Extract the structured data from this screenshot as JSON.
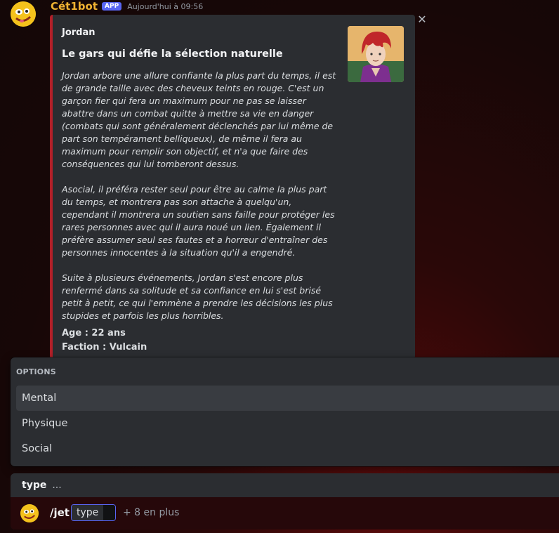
{
  "message": {
    "username": "Cét1bot",
    "badge": "APP",
    "timestamp": "Aujourd'hui à 09:56"
  },
  "embed": {
    "author": "Jordan",
    "title": "Le gars qui défie la sélection naturelle",
    "description": [
      "Jordan arbore une allure confiante la plus part du temps, il est de grande taille avec des cheveux teints en rouge. C'est un garçon fier qui fera un maximum pour ne pas se laisser abattre dans un combat quitte à mettre sa vie en danger (combats qui sont généralement déclenchés par lui même de part son tempérament belliqueux), de même il fera au maximum pour remplir son objectif, et n'a que faire des conséquences qui lui tomberont dessus.",
      "Asocial, il préféra rester seul pour être au calme la plus part du temps, et montrera pas son attache à quelqu'un, cependant il montrera un soutien sans faille pour protéger les rares personnes avec qui il aura noué un lien. Également il préfère assumer seul ses fautes et a horreur d'entraîner des personnes innocentes à la situation qu'il a engendré.",
      "Suite à plusieurs événements, Jordan s'est encore plus renfermé dans sa solitude et sa confiance en lui s'est brisé petit à petit, ce qui l'emmène a prendre les décisions les plus stupides et parfois les plus horribles."
    ],
    "fields": {
      "age": "Age : 22 ans",
      "faction": "Faction : Vulcain"
    }
  },
  "options": {
    "header": "OPTIONS",
    "items": [
      "Mental",
      "Physique",
      "Social"
    ]
  },
  "input": {
    "hint_name": "type",
    "hint_dots": "...",
    "command": "/jet",
    "param_label": "type",
    "more": "+ 8 en plus"
  },
  "colors": {
    "accent_border": "#b31f28",
    "username": "#f0b232",
    "badge": "#5865f2"
  },
  "icons": {
    "close": "close-icon"
  }
}
